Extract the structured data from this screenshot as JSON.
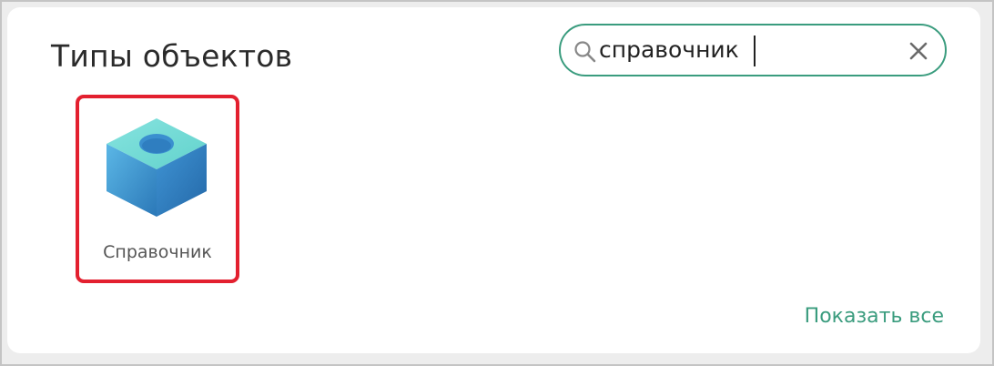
{
  "header": {
    "title": "Типы объектов"
  },
  "search": {
    "value": "справочник",
    "icon": "search-icon",
    "clear_icon": "close-icon",
    "border_color": "#3a9c7e"
  },
  "object_types": [
    {
      "label": "Справочник",
      "icon": "cube-icon",
      "selected": true
    }
  ],
  "footer": {
    "show_all_label": "Показать все"
  },
  "colors": {
    "accent": "#3a9c7e",
    "selection": "#e3202f"
  }
}
